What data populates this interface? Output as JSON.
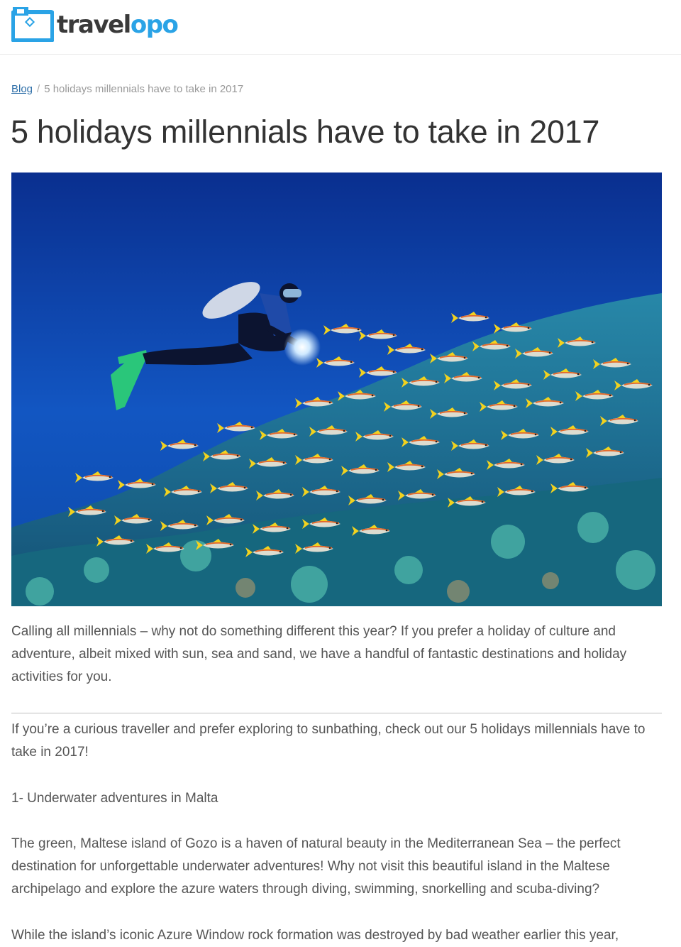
{
  "brand": {
    "name_part1": "travel",
    "name_part2": "opo",
    "colors": {
      "accent": "#2aa3e6",
      "dark": "#3a3a3a",
      "link": "#2d6ea8"
    }
  },
  "breadcrumb": {
    "home_label": "Blog",
    "separator": "/",
    "current": "5 holidays millennials have to take in 2017"
  },
  "article": {
    "title": "5 holidays millennials have to take in 2017",
    "intro": "Calling all millennials – why not do something different this year? If you prefer a holiday of culture and adventure, albeit mixed with sun, sea and sand, we have a handful of fantastic destinations and holiday activities for you.",
    "para_two": "If you’re a curious traveller and prefer exploring to sunbathing, check out our 5 holidays millennials have to take in 2017!",
    "section_heading": "1- Underwater adventures in Malta",
    "para_gozo": "The green, Maltese island of Gozo is a haven of natural beauty in the Mediterranean Sea – the perfect destination for unforgettable underwater adventures! Why not visit this beautiful island in the Maltese archipelago and explore the azure waters through diving, swimming, snorkelling and scuba-diving?",
    "para_azure": "While the island’s iconic Azure Window rock formation was destroyed by bad weather earlier this year,"
  },
  "hero_image": {
    "icon": "scuba-diver-photo",
    "colors": {
      "water_top": "#0a2f8f",
      "water_mid": "#1256c2",
      "fish_yellow": "#f2d21f",
      "fish_stripe": "#e26a2c",
      "reef": "#1e8f9a"
    }
  }
}
